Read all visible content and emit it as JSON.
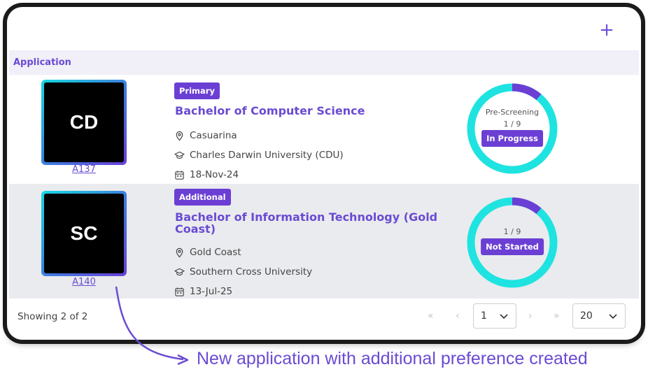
{
  "header": {
    "add_icon": "plus-icon"
  },
  "section": {
    "title": "Application"
  },
  "applications": [
    {
      "initials": "CD",
      "id": "A137",
      "preference": "Primary",
      "course": "Bachelor of Computer Science",
      "location": "Casuarina",
      "university": "Charles Darwin University (CDU)",
      "date": "18-Nov-24",
      "stage": "Pre-Screening",
      "step": "1 / 9",
      "status": "In Progress",
      "progress_fraction": 0.111
    },
    {
      "initials": "SC",
      "id": "A140",
      "preference": "Additional",
      "course": "Bachelor of Information Technology (Gold Coast)",
      "location": "Gold Coast",
      "university": "Southern Cross University",
      "date": "13-Jul-25",
      "stage": "",
      "step": "1 / 9",
      "status": "Not Started",
      "progress_fraction": 0.111
    }
  ],
  "footer": {
    "showing": "Showing 2 of 2",
    "page": "1",
    "page_size": "20",
    "first_icon": "double-chevron-left-icon",
    "prev_icon": "chevron-left-icon",
    "next_icon": "chevron-right-icon",
    "last_icon": "double-chevron-right-icon"
  },
  "annotation": {
    "text": "New application with additional preference created"
  },
  "colors": {
    "accent": "#6a4bd3",
    "badge": "#6b3fd4",
    "ring": "#1fe3e0",
    "ring_progress": "#6b3fd4",
    "row_alt": "#e9ebee",
    "section_bg": "#f1eff8"
  }
}
